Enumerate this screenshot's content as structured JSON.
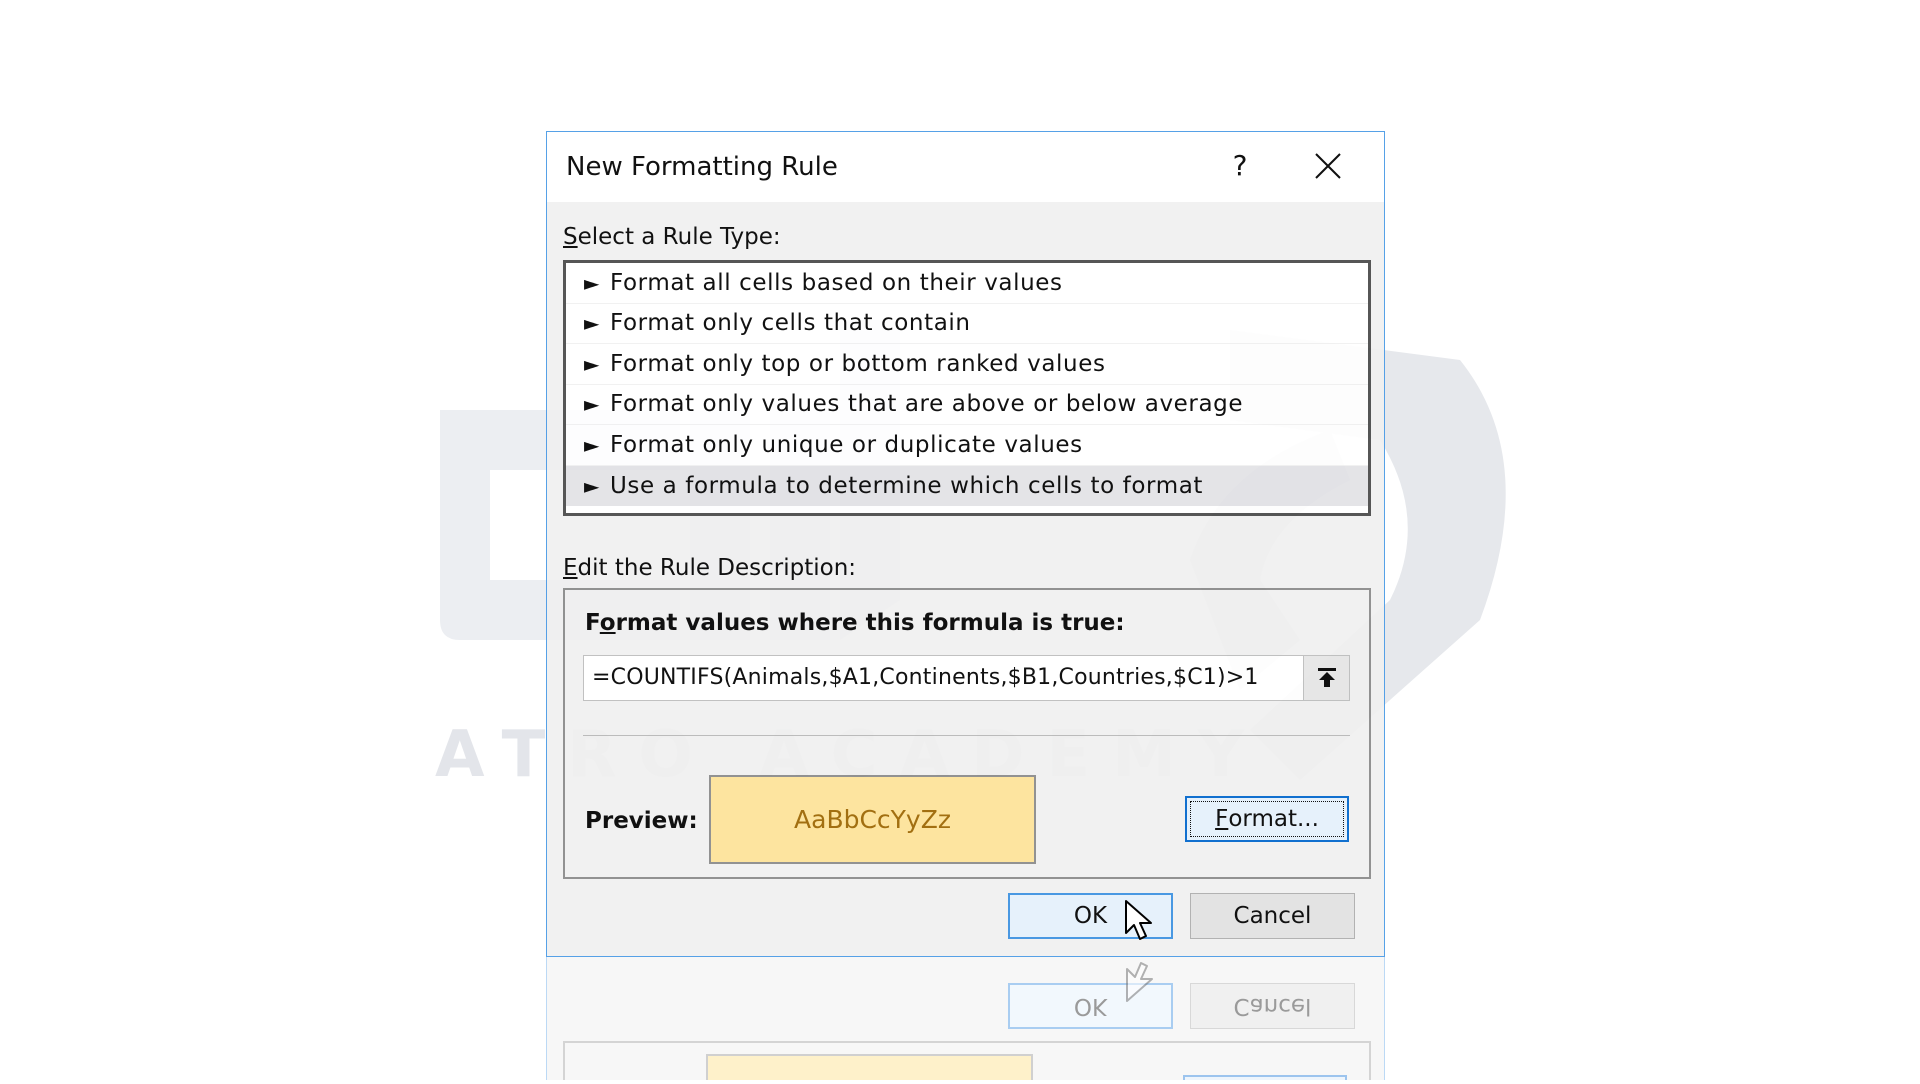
{
  "watermark": {
    "text": "ATRO ACADEMY"
  },
  "dialog": {
    "title": "New Formatting Rule",
    "help_label": "?",
    "select_rule_type": {
      "label_first": "S",
      "label_rest": "elect a Rule Type:"
    },
    "rule_types": [
      "Format all cells based on their values",
      "Format only cells that contain",
      "Format only top or bottom ranked values",
      "Format only values that are above or below average",
      "Format only unique or duplicate values",
      "Use a formula to determine which cells to format"
    ],
    "selected_rule_index": 5,
    "edit_description": {
      "label_first": "E",
      "label_rest": "dit the Rule Description:"
    },
    "formula_heading": {
      "before": "F",
      "underlined": "o",
      "after": "rmat values where this formula is true:"
    },
    "formula_value": "=COUNTIFS(Animals,$A1,Continents,$B1,Countries,$C1)>1",
    "preview_label": "Preview:",
    "preview_sample": "AaBbCcYyZz",
    "format_button": {
      "underlined": "F",
      "rest": "ormat..."
    },
    "ok_label": "OK",
    "cancel_label": "Cancel"
  },
  "colors": {
    "preview_fill": "#fde398",
    "preview_text": "#9c6500",
    "accent": "#0066cc"
  }
}
